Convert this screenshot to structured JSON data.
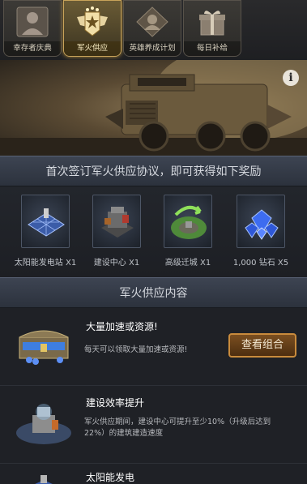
{
  "tabs": [
    {
      "label": "幸存者庆典",
      "icon": "survivor-portrait-icon",
      "active": false
    },
    {
      "label": "军火供应",
      "icon": "winged-star-badge-icon",
      "active": true
    },
    {
      "label": "英雄养成计划",
      "icon": "hero-portrait-icon",
      "active": false
    },
    {
      "label": "每日补给",
      "icon": "gift-box-icon",
      "active": false
    }
  ],
  "banner": {
    "info_symbol": "i"
  },
  "rewards_header": "首次签订军火供应协议，即可获得如下奖励",
  "rewards": [
    {
      "label": "太阳能发电站 X1",
      "icon": "solar-plant-icon"
    },
    {
      "label": "建设中心 X1",
      "icon": "construction-center-icon"
    },
    {
      "label": "高级迁城 X1",
      "icon": "advanced-relocation-icon"
    },
    {
      "label": "1,000 钻石 X5",
      "icon": "diamond-icon"
    }
  ],
  "supply_header": "军火供应内容",
  "items": [
    {
      "title": "大量加速或资源!",
      "desc": "每天可以领取大量加速或资源!",
      "button": "查看组合",
      "icon": "treasure-chest-icon"
    },
    {
      "title": "建设效率提升",
      "desc_line1": "军火供应期间，建设中心可提升至少10%（升级后达到",
      "desc_line2": "22%）的建筑建造速度",
      "icon": "construction-center-icon"
    },
    {
      "title": "太阳能发电",
      "icon": "solar-plant-icon"
    }
  ],
  "colors": {
    "accent_gold": "#c8a35a",
    "button_border": "#c98b3c",
    "header_bar": "#3d4452"
  }
}
